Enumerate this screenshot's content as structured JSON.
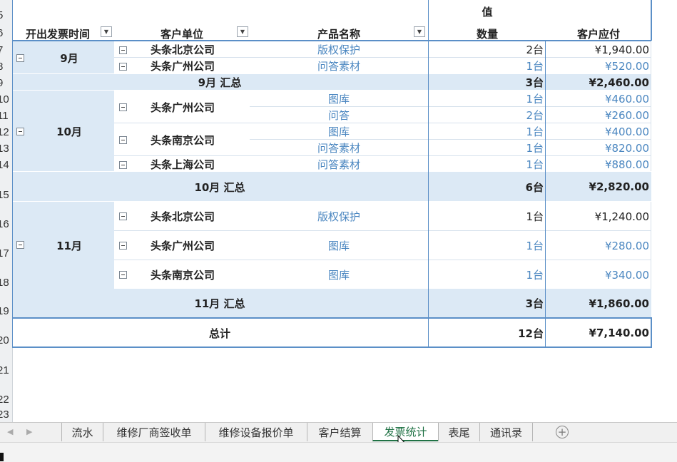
{
  "row_numbers": [
    "5",
    "6",
    "7",
    "8",
    "9",
    "10",
    "11",
    "12",
    "13",
    "14",
    "15",
    "16",
    "17",
    "18",
    "19",
    "20",
    "21",
    "22",
    "23"
  ],
  "headers": {
    "value_label": "值",
    "invoice_time": "开出发票时间",
    "customer": "客户单位",
    "product": "产品名称",
    "quantity": "数量",
    "amount": "客户应付"
  },
  "groups": [
    {
      "month": "9月",
      "rows": [
        {
          "customer": "头条北京公司",
          "product": "版权保护",
          "qty": "2台",
          "amount": "¥1,940.00"
        },
        {
          "customer": "头条广州公司",
          "product": "问答素材",
          "qty": "1台",
          "amount": "¥520.00"
        }
      ],
      "subtotal_label": "9月 汇总",
      "subtotal_qty": "3台",
      "subtotal_amount": "¥2,460.00"
    },
    {
      "month": "10月",
      "rows": [
        {
          "customer": "头条广州公司",
          "product": "图库",
          "qty": "1台",
          "amount": "¥460.00"
        },
        {
          "customer": "",
          "product": "问答",
          "qty": "2台",
          "amount": "¥260.00"
        },
        {
          "customer": "头条南京公司",
          "product": "图库",
          "qty": "1台",
          "amount": "¥400.00"
        },
        {
          "customer": "",
          "product": "问答素材",
          "qty": "1台",
          "amount": "¥820.00"
        },
        {
          "customer": "头条上海公司",
          "product": "问答素材",
          "qty": "1台",
          "amount": "¥880.00"
        }
      ],
      "subtotal_label": "10月 汇总",
      "subtotal_qty": "6台",
      "subtotal_amount": "¥2,820.00"
    },
    {
      "month": "11月",
      "rows": [
        {
          "customer": "头条北京公司",
          "product": "版权保护",
          "qty": "1台",
          "amount": "¥1,240.00"
        },
        {
          "customer": "头条广州公司",
          "product": "图库",
          "qty": "1台",
          "amount": "¥280.00"
        },
        {
          "customer": "头条南京公司",
          "product": "图库",
          "qty": "1台",
          "amount": "¥340.00"
        }
      ],
      "subtotal_label": "11月 汇总",
      "subtotal_qty": "3台",
      "subtotal_amount": "¥1,860.00"
    }
  ],
  "grand_total": {
    "label": "总计",
    "qty": "12台",
    "amount": "¥7,140.00"
  },
  "sheet_tabs": [
    "流水",
    "维修厂商签收单",
    "维修设备报价单",
    "客户结算",
    "发票统计",
    "表尾",
    "通讯录"
  ],
  "active_tab": "发票统计",
  "colors": {
    "accent_blue": "#5b8fc7",
    "band": "#dce9f5",
    "link_text": "#4a86c0",
    "active_tab": "#207245"
  }
}
